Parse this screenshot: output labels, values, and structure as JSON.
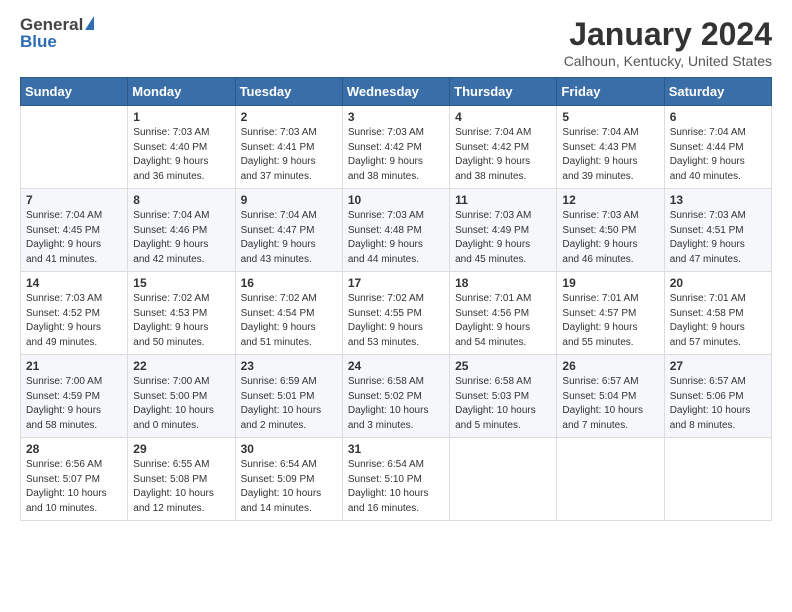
{
  "header": {
    "logo_general": "General",
    "logo_blue": "Blue",
    "month_title": "January 2024",
    "subtitle": "Calhoun, Kentucky, United States"
  },
  "days_of_week": [
    "Sunday",
    "Monday",
    "Tuesday",
    "Wednesday",
    "Thursday",
    "Friday",
    "Saturday"
  ],
  "weeks": [
    [
      {
        "day": "",
        "info": ""
      },
      {
        "day": "1",
        "info": "Sunrise: 7:03 AM\nSunset: 4:40 PM\nDaylight: 9 hours\nand 36 minutes."
      },
      {
        "day": "2",
        "info": "Sunrise: 7:03 AM\nSunset: 4:41 PM\nDaylight: 9 hours\nand 37 minutes."
      },
      {
        "day": "3",
        "info": "Sunrise: 7:03 AM\nSunset: 4:42 PM\nDaylight: 9 hours\nand 38 minutes."
      },
      {
        "day": "4",
        "info": "Sunrise: 7:04 AM\nSunset: 4:42 PM\nDaylight: 9 hours\nand 38 minutes."
      },
      {
        "day": "5",
        "info": "Sunrise: 7:04 AM\nSunset: 4:43 PM\nDaylight: 9 hours\nand 39 minutes."
      },
      {
        "day": "6",
        "info": "Sunrise: 7:04 AM\nSunset: 4:44 PM\nDaylight: 9 hours\nand 40 minutes."
      }
    ],
    [
      {
        "day": "7",
        "info": "Sunrise: 7:04 AM\nSunset: 4:45 PM\nDaylight: 9 hours\nand 41 minutes."
      },
      {
        "day": "8",
        "info": "Sunrise: 7:04 AM\nSunset: 4:46 PM\nDaylight: 9 hours\nand 42 minutes."
      },
      {
        "day": "9",
        "info": "Sunrise: 7:04 AM\nSunset: 4:47 PM\nDaylight: 9 hours\nand 43 minutes."
      },
      {
        "day": "10",
        "info": "Sunrise: 7:03 AM\nSunset: 4:48 PM\nDaylight: 9 hours\nand 44 minutes."
      },
      {
        "day": "11",
        "info": "Sunrise: 7:03 AM\nSunset: 4:49 PM\nDaylight: 9 hours\nand 45 minutes."
      },
      {
        "day": "12",
        "info": "Sunrise: 7:03 AM\nSunset: 4:50 PM\nDaylight: 9 hours\nand 46 minutes."
      },
      {
        "day": "13",
        "info": "Sunrise: 7:03 AM\nSunset: 4:51 PM\nDaylight: 9 hours\nand 47 minutes."
      }
    ],
    [
      {
        "day": "14",
        "info": "Sunrise: 7:03 AM\nSunset: 4:52 PM\nDaylight: 9 hours\nand 49 minutes."
      },
      {
        "day": "15",
        "info": "Sunrise: 7:02 AM\nSunset: 4:53 PM\nDaylight: 9 hours\nand 50 minutes."
      },
      {
        "day": "16",
        "info": "Sunrise: 7:02 AM\nSunset: 4:54 PM\nDaylight: 9 hours\nand 51 minutes."
      },
      {
        "day": "17",
        "info": "Sunrise: 7:02 AM\nSunset: 4:55 PM\nDaylight: 9 hours\nand 53 minutes."
      },
      {
        "day": "18",
        "info": "Sunrise: 7:01 AM\nSunset: 4:56 PM\nDaylight: 9 hours\nand 54 minutes."
      },
      {
        "day": "19",
        "info": "Sunrise: 7:01 AM\nSunset: 4:57 PM\nDaylight: 9 hours\nand 55 minutes."
      },
      {
        "day": "20",
        "info": "Sunrise: 7:01 AM\nSunset: 4:58 PM\nDaylight: 9 hours\nand 57 minutes."
      }
    ],
    [
      {
        "day": "21",
        "info": "Sunrise: 7:00 AM\nSunset: 4:59 PM\nDaylight: 9 hours\nand 58 minutes."
      },
      {
        "day": "22",
        "info": "Sunrise: 7:00 AM\nSunset: 5:00 PM\nDaylight: 10 hours\nand 0 minutes."
      },
      {
        "day": "23",
        "info": "Sunrise: 6:59 AM\nSunset: 5:01 PM\nDaylight: 10 hours\nand 2 minutes."
      },
      {
        "day": "24",
        "info": "Sunrise: 6:58 AM\nSunset: 5:02 PM\nDaylight: 10 hours\nand 3 minutes."
      },
      {
        "day": "25",
        "info": "Sunrise: 6:58 AM\nSunset: 5:03 PM\nDaylight: 10 hours\nand 5 minutes."
      },
      {
        "day": "26",
        "info": "Sunrise: 6:57 AM\nSunset: 5:04 PM\nDaylight: 10 hours\nand 7 minutes."
      },
      {
        "day": "27",
        "info": "Sunrise: 6:57 AM\nSunset: 5:06 PM\nDaylight: 10 hours\nand 8 minutes."
      }
    ],
    [
      {
        "day": "28",
        "info": "Sunrise: 6:56 AM\nSunset: 5:07 PM\nDaylight: 10 hours\nand 10 minutes."
      },
      {
        "day": "29",
        "info": "Sunrise: 6:55 AM\nSunset: 5:08 PM\nDaylight: 10 hours\nand 12 minutes."
      },
      {
        "day": "30",
        "info": "Sunrise: 6:54 AM\nSunset: 5:09 PM\nDaylight: 10 hours\nand 14 minutes."
      },
      {
        "day": "31",
        "info": "Sunrise: 6:54 AM\nSunset: 5:10 PM\nDaylight: 10 hours\nand 16 minutes."
      },
      {
        "day": "",
        "info": ""
      },
      {
        "day": "",
        "info": ""
      },
      {
        "day": "",
        "info": ""
      }
    ]
  ]
}
